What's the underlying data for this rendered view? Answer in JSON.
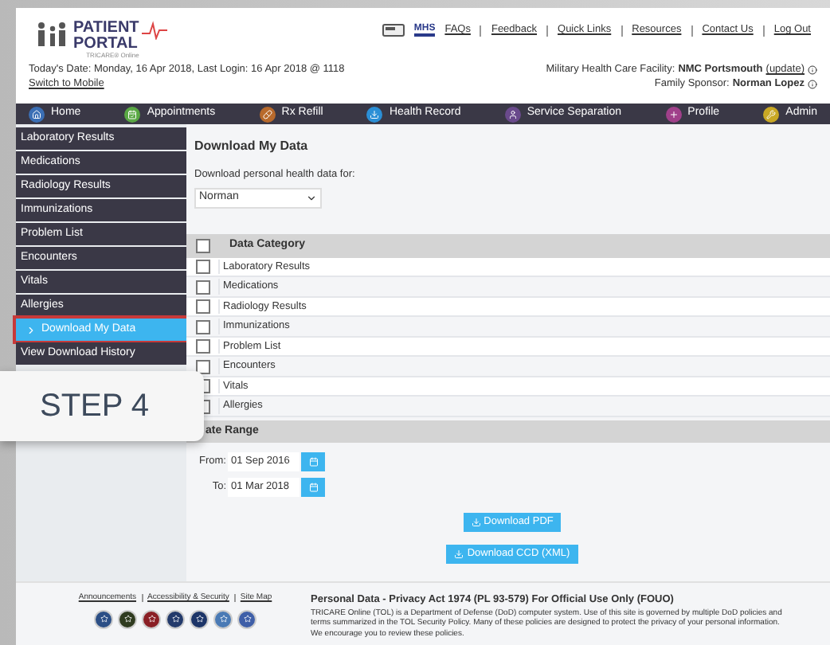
{
  "header": {
    "logo": {
      "line1": "PATIENT",
      "line2": "PORTAL",
      "tagline": "TRICARE® Online"
    },
    "badge": "MHS",
    "links": [
      "FAQs",
      "Feedback",
      "Quick Links",
      "Resources",
      "Contact Us",
      "Log Out"
    ],
    "date_line": "Today's Date: Monday, 16 Apr 2018, Last Login: 16 Apr 2018 @ 1118",
    "mobile_link": "Switch to Mobile",
    "facility": {
      "label": "Military Health Care Facility:",
      "value": "NMC Portsmouth",
      "link": "(update)"
    },
    "sponsor": {
      "label": "Family Sponsor:",
      "value": "Norman Lopez"
    }
  },
  "nav": [
    {
      "label": "Home",
      "kind": "home"
    },
    {
      "label": "Appointments",
      "kind": "calendar"
    },
    {
      "label": "Rx Refill",
      "kind": "pill"
    },
    {
      "label": "Health Record",
      "kind": "download"
    },
    {
      "label": "Service Separation",
      "kind": "person"
    },
    {
      "label": "Profile",
      "kind": "profile"
    },
    {
      "label": "Admin",
      "kind": "tools"
    }
  ],
  "sidebar": {
    "items": [
      {
        "label": "Laboratory Results",
        "selected": false
      },
      {
        "label": "Medications",
        "selected": false
      },
      {
        "label": "Radiology Results",
        "selected": false
      },
      {
        "label": "Immunizations",
        "selected": false
      },
      {
        "label": "Problem List",
        "selected": false
      },
      {
        "label": "Encounters",
        "selected": false
      },
      {
        "label": "Vitals",
        "selected": false
      },
      {
        "label": "Allergies",
        "selected": false
      },
      {
        "label": "Download My Data",
        "selected": true
      },
      {
        "label": "View Download History",
        "selected": false
      }
    ]
  },
  "main": {
    "title": "Download My Data",
    "for_label": "Download personal health data for:",
    "person": "Norman",
    "table": {
      "header": "Data Category",
      "header_checked": false,
      "rows": [
        {
          "label": "Laboratory Results",
          "checked": false
        },
        {
          "label": "Medications",
          "checked": false
        },
        {
          "label": "Radiology Results",
          "checked": false
        },
        {
          "label": "Immunizations",
          "checked": false
        },
        {
          "label": "Problem List",
          "checked": false
        },
        {
          "label": "Encounters",
          "checked": false
        },
        {
          "label": "Vitals",
          "checked": false
        },
        {
          "label": "Allergies",
          "checked": false
        }
      ]
    },
    "date_range": {
      "header": "ate Range",
      "from_label": "From:",
      "from": "01 Sep 2016",
      "to_label": "To:",
      "to": "01 Mar 2018"
    },
    "buttons": [
      "Download PDF",
      "Download CCD (XML)"
    ]
  },
  "footer": {
    "links": [
      "Announcements",
      "Accessibility & Security",
      "Site Map"
    ],
    "notice_title": "Personal Data - Privacy Act 1974 (PL 93-579)  For Official Use Only (FOUO)",
    "notice": "TRICARE Online (TOL) is a Department of Defense (DoD) computer system. Use of this site is governed by multiple DoD policies and terms summarized in the TOL Security Policy. Many of these policies are designed to protect the privacy of your personal information. We encourage you to review these policies."
  },
  "callout": "STEP 4"
}
